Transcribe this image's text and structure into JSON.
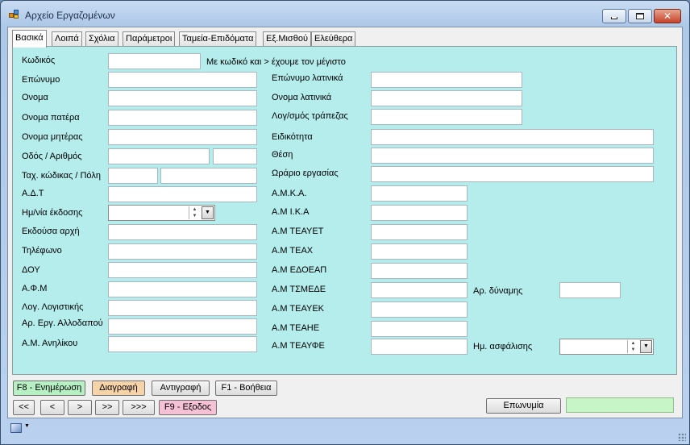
{
  "window": {
    "title": "Αρχείο Εργαζομένων"
  },
  "tabs": [
    "Βασικά",
    "Λοιπά",
    "Σχόλια",
    "Παράμετροι",
    "Ταμεία-Επιδόματα",
    "Εξ.Μισθού",
    "Ελεύθερα"
  ],
  "left_labels": {
    "code": "Κωδικός",
    "surname": "Επώνυμο",
    "name": "Ονομα",
    "father": "Ονομα πατέρα",
    "mother": "Ονομα μητέρας",
    "street": "Οδός / Αριθμός",
    "postal": "Ταχ. κώδικας / Πόλη",
    "adt": "Α.Δ.Τ",
    "issue_date": "Ημ/νία έκδοσης",
    "authority": "Εκδούσα αρχή",
    "phone": "Τηλέφωνο",
    "doy": "ΔΟΥ",
    "afm": "Α.Φ.Μ",
    "account": "Λογ. Λογιστικής",
    "foreign": "Αρ. Εργ. Αλλοδαπού",
    "minor": "Α.Μ. Ανηλίκου"
  },
  "code_hint": "Με κωδικό και > έχουμε τον μέγιστο",
  "right_labels": {
    "surname_latin": "Επώνυμο λατινικά",
    "name_latin": "Ονομα λατινικά",
    "bank": "Λογ/σμός τράπεζας",
    "specialty": "Ειδικότητα",
    "position": "Θέση",
    "hours": "Ωράριο εργασίας",
    "amka": "Α.Μ.Κ.Α.",
    "ika": "Α.Μ  Ι.Κ.Α",
    "teayet": "Α.Μ  ΤΕΑΥΕΤ",
    "teax": "Α.Μ  ΤΕΑΧ",
    "edoeap": "Α.Μ  ΕΔΟΕΑΠ",
    "tsmede": "Α.Μ  ΤΣΜΕΔΕ",
    "teayek": "Α.Μ  ΤΕΑΥΕΚ",
    "teahe": "Α.Μ  ΤΕΑΗΕ",
    "teayfe": "Α.Μ  ΤΕΑΥΦΕ",
    "force": "Αρ. δύναμης",
    "insurance_date": "Ημ. ασφάλισης"
  },
  "buttons": {
    "update": "F8 - Ενημέρωση",
    "delete": "Διαγραφή",
    "copy": "Αντιγραφή",
    "help": "F1 - Βοήθεια",
    "first": "<<",
    "prev": "<",
    "next": ">",
    "next_page": ">>",
    "last": ">>>",
    "exit": "F9 - Εξοδος",
    "surname_search": "Επωνυμία"
  },
  "icons": {
    "app": "app-grid-icon",
    "status": "form-icon",
    "grip": "resize-grip-icon"
  }
}
